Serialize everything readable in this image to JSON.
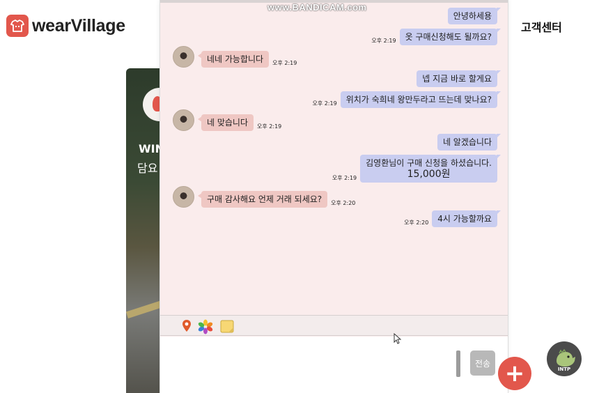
{
  "header": {
    "logo_text": "wearVillage",
    "support_label": "고객센터"
  },
  "background_card": {
    "title_partial": "WIN",
    "subtitle_partial": "담요"
  },
  "watermark": "www.BANDICAM.com",
  "chat": {
    "messages": [
      {
        "from": "me",
        "text": "안녕하세용",
        "time": ""
      },
      {
        "from": "me",
        "text": "옷 구매신청해도 될까요?",
        "time": "오후 2:19"
      },
      {
        "from": "them",
        "text": "네네 가능합니다",
        "time": "오후 2:19"
      },
      {
        "from": "me",
        "text": "넵 지금 바로 할게요",
        "time": ""
      },
      {
        "from": "me",
        "text": "위치가 숙희네 왕만두라고 뜨는데 맞나요?",
        "time": "오후 2:19"
      },
      {
        "from": "them",
        "text": "네 맞습니다",
        "time": "오후 2:19"
      },
      {
        "from": "me",
        "text": "네 알겠습니다",
        "time": ""
      },
      {
        "from": "me",
        "text": "김영환님이 구매 신청을 하셨습니다.",
        "amount": "15,000원",
        "time": "오후 2:19"
      },
      {
        "from": "them",
        "text": "구매 감사해요 언제 거래 되세요?",
        "time": "오후 2:20"
      },
      {
        "from": "me",
        "text": "4시 가능할까요",
        "time": "오후 2:20"
      }
    ],
    "toolbar_icons": [
      "location-pin-icon",
      "photos-icon",
      "memo-icon"
    ],
    "input_value": "",
    "send_label": "전송"
  },
  "fab_symbol": "+",
  "profile_badge": "INTP",
  "colors": {
    "brand": "#e2574c",
    "chat_bg": "#faecec",
    "my_bubble": "#c9cdf0",
    "their_bubble": "#efc7c3"
  }
}
